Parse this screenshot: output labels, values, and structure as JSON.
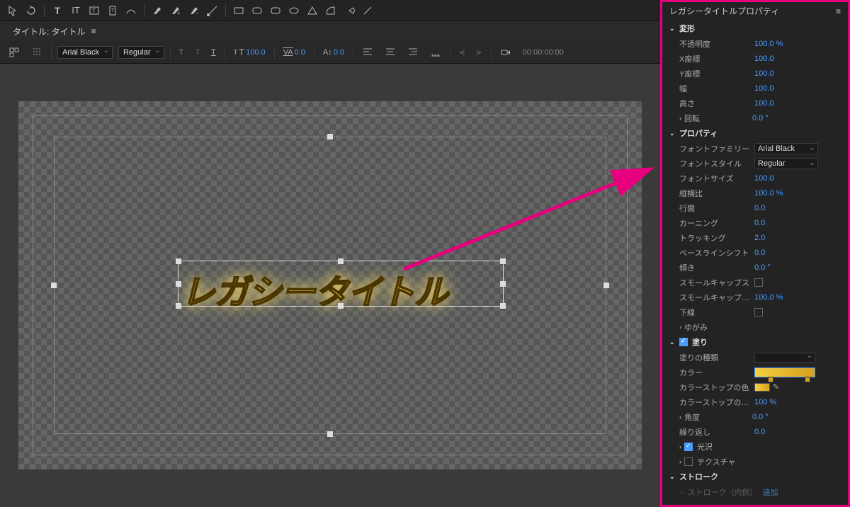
{
  "topTools": [
    "select",
    "type-horizontal",
    "type-vertical",
    "area-type",
    "area-type-v",
    "path-type",
    "pen",
    "add-anchor",
    "delete-anchor",
    "convert",
    "rect",
    "rounded-rect",
    "wedge",
    "ellipse",
    "triangle",
    "arc",
    "fan",
    "line"
  ],
  "tab": {
    "label": "タイトル: タイトル",
    "menu": "≡"
  },
  "toolbar2": {
    "fontFamily": "Arial Black",
    "fontStyle": "Regular",
    "fontSize": "100.0",
    "kerning": "0.0",
    "leading": "0.0",
    "timecode": "00:00:00:00"
  },
  "canvas": {
    "titleText": "レガシータイトル"
  },
  "panel": {
    "title": "レガシータイトルプロパティ",
    "sections": {
      "transform": {
        "label": "変形",
        "opacity": {
          "label": "不透明度",
          "value": "100.0 %"
        },
        "x": {
          "label": "X座標",
          "value": "100.0"
        },
        "y": {
          "label": "Y座標",
          "value": "100.0"
        },
        "width": {
          "label": "幅",
          "value": "100.0"
        },
        "height": {
          "label": "高さ",
          "value": "100.0"
        },
        "rotation": {
          "label": "回転",
          "value": "0.0 °"
        }
      },
      "properties": {
        "label": "プロパティ",
        "fontFamily": {
          "label": "フォントファミリー",
          "value": "Arial Black"
        },
        "fontStyle": {
          "label": "フォントスタイル",
          "value": "Regular"
        },
        "fontSize": {
          "label": "フォントサイズ",
          "value": "100.0"
        },
        "aspect": {
          "label": "縦横比",
          "value": "100.0 %"
        },
        "leading": {
          "label": "行間",
          "value": "0.0"
        },
        "kerning": {
          "label": "カーニング",
          "value": "0.0"
        },
        "tracking": {
          "label": "トラッキング",
          "value": "2.0"
        },
        "baseline": {
          "label": "ベースラインシフト",
          "value": "0.0"
        },
        "slant": {
          "label": "傾き",
          "value": "0.0 °"
        },
        "smallCaps": {
          "label": "スモールキャップス"
        },
        "smallCapsSize": {
          "label": "スモールキャップス...",
          "value": "100.0 %"
        },
        "underline": {
          "label": "下線"
        },
        "distort": {
          "label": "ゆがみ"
        }
      },
      "fill": {
        "label": "塗り",
        "fillType": {
          "label": "塗りの種類"
        },
        "color": {
          "label": "カラー"
        },
        "stopColor": {
          "label": "カラーストップの色"
        },
        "stopOpacity": {
          "label": "カラーストップの不...",
          "value": "100 %"
        },
        "angle": {
          "label": "角度",
          "value": "0.0 °"
        },
        "repeat": {
          "label": "繰り返し",
          "value": "0.0"
        },
        "sheen": {
          "label": "光沢"
        },
        "texture": {
          "label": "テクスチャ"
        }
      },
      "stroke": {
        "label": "ストローク",
        "inner": {
          "label": "ストローク（内側）",
          "add": "追加"
        }
      }
    }
  }
}
